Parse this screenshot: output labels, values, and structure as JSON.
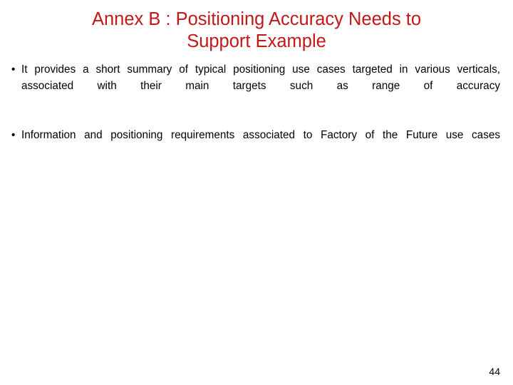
{
  "slide": {
    "background_color": "#ffffff",
    "title": {
      "color": "#C41818",
      "lines": [
        "Annex B : Positioning Accuracy Needs to",
        "Support Example"
      ],
      "full_text": "Annex B : Positioning Accuracy Needs to Support Example"
    },
    "bullets": [
      {
        "marker": "•",
        "text": "It provides a short summary of typical positioning use cases targeted in various verticals, associated with their main targets such as range of accuracy"
      },
      {
        "marker": "•",
        "text": "Information and positioning requirements associated to Factory of the Future use cases"
      }
    ],
    "page_number": "44"
  }
}
